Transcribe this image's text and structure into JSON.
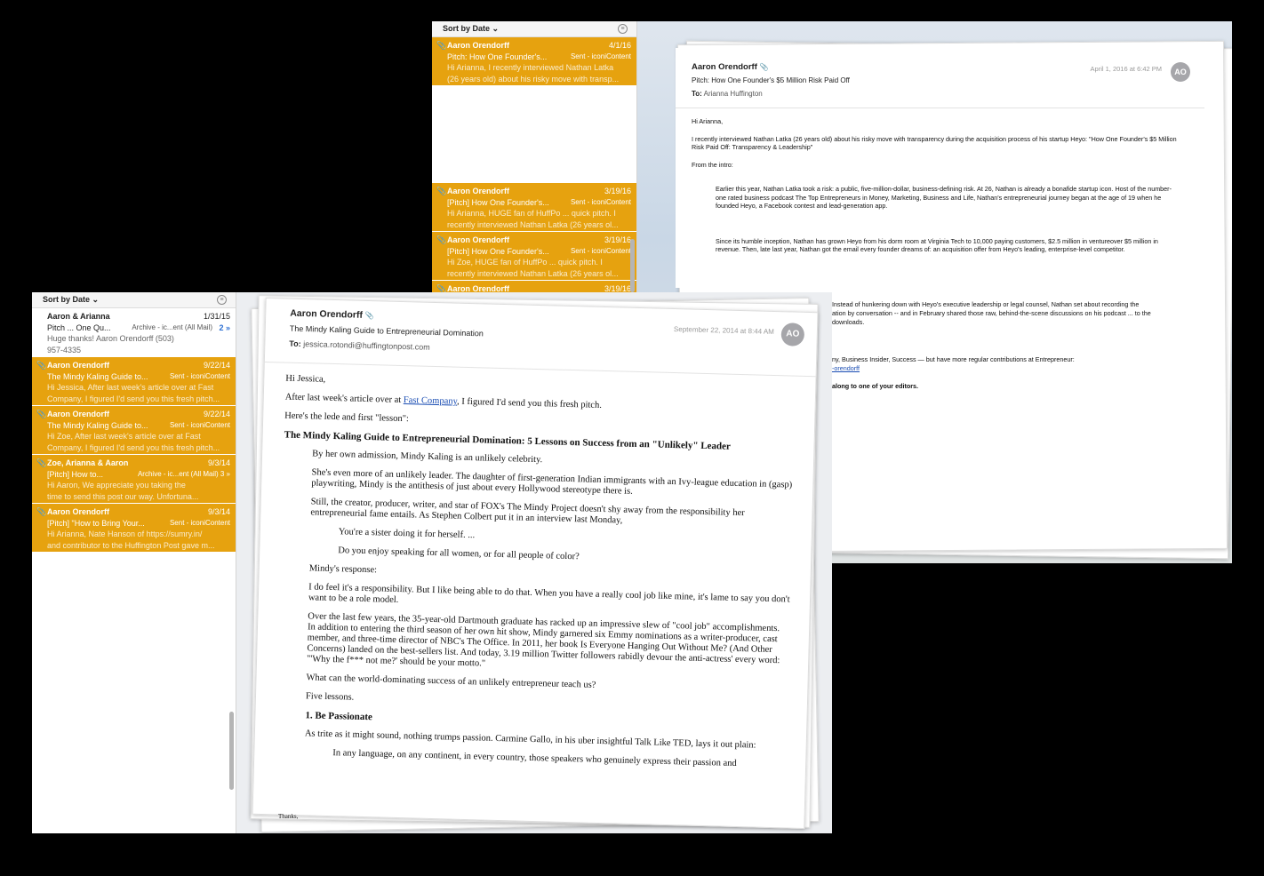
{
  "back_window": {
    "sort_label": "Sort by Date ⌄",
    "filter_icon": "filter-icon",
    "messages": [
      {
        "from": "Aaron Orendorff",
        "date": "4/1/16",
        "subject": "Pitch: How One Founder's...",
        "folder": "Sent - iconiContent",
        "preview1": "Hi Arianna, I recently interviewed Nathan Latka",
        "preview2": "(26 years old) about his risky move with transp..."
      },
      {
        "from": "Aaron Orendorff",
        "date": "3/19/16",
        "subject": "[Pitch] How One Founder's...",
        "folder": "Sent - iconiContent",
        "preview1": "Hi Arianna, HUGE fan of HuffPo ... quick pitch. I",
        "preview2": "recently interviewed Nathan Latka (26 years ol..."
      },
      {
        "from": "Aaron Orendorff",
        "date": "3/19/16",
        "subject": "[Pitch] How One Founder's...",
        "folder": "Sent - iconiContent",
        "preview1": "Hi Zoe, HUGE fan of HuffPo ... quick pitch. I",
        "preview2": "recently interviewed Nathan Latka (26 years ol..."
      },
      {
        "from": "Aaron Orendorff",
        "date": "3/19/16"
      }
    ],
    "email": {
      "name": "Aaron Orendorff",
      "subject": "Pitch: How One Founder's $5 Million Risk Paid Off",
      "to_label": "To:",
      "to": "Arianna Huffington",
      "date": "April 1, 2016 at 6:42 PM",
      "avatar": "AO",
      "greeting": "Hi Arianna,",
      "p1": "I recently interviewed Nathan Latka (26 years old) about his risky move with transparency during the acquisition process of his startup Heyo: \"How One Founder's $5 Million Risk Paid Off: Transparency & Leadership\"",
      "p2": "From the intro:",
      "q1": "Earlier this year, Nathan Latka took a risk: a public, five-million-dollar, business-defining risk. At 26, Nathan is already a bonafide startup icon. Host of the number-one rated business podcast The Top Entrepreneurs in Money, Marketing, Business and Life, Nathan's entrepreneurial journey began at the age of 19 when he founded Heyo, a Facebook contest and lead-generation app.",
      "q2": "Since its humble inception, Nathan has grown Heyo from his dorm room at Virginia Tech to 10,000 paying customers, $2.5 million in ventureover $5 million in revenue. Then, late last year, Nathan got the email every founder dreams of: an acquisition offer from Heyo's leading, enterprise-level competitor.",
      "q3a": "Instead of hunkering down with Heyo's executive leadership or legal counsel, Nathan set about recording the",
      "q3b": "ation by conversation -- and in February shared those raw, behind-the-scene discussions on his podcast ... to the",
      "q3c": "downloads.",
      "p3": "ny, Business Insider, Success — but have more regular contributions at Entrepreneur:",
      "p3link": "-orendorff",
      "p4": "along to one of your editors."
    }
  },
  "front_window": {
    "sort_label": "Sort by Date ⌄",
    "filter_icon": "filter-icon",
    "messages": [
      {
        "from": "Aaron & Arianna",
        "date": "1/31/15",
        "subject": "Pitch ... One Qu...",
        "folder": "Archive - ic...ent (All Mail)",
        "count": "2 »",
        "preview1": "Huge thanks! Aaron Orendorff (503)",
        "preview2": "957-4335"
      },
      {
        "from": "Aaron Orendorff",
        "date": "9/22/14",
        "subject": "The Mindy Kaling Guide to...",
        "folder": "Sent - iconiContent",
        "preview1": "Hi Jessica, After last week's article over at Fast",
        "preview2": "Company, I figured I'd send you this fresh pitch..."
      },
      {
        "from": "Aaron Orendorff",
        "date": "9/22/14",
        "subject": "The Mindy Kaling Guide to...",
        "folder": "Sent - iconiContent",
        "preview1": "Hi Zoe, After last week's article over at Fast",
        "preview2": "Company, I figured I'd send you this fresh pitch..."
      },
      {
        "from": "Zoe, Arianna & Aaron",
        "date": "9/3/14",
        "subject": "[Pitch] How to...",
        "folder": "Archive - ic...ent (All Mail)  3 »",
        "preview1": "Hi Aaron, We appreciate you taking the",
        "preview2": "time to send this post our way. Unfortuna..."
      },
      {
        "from": "Aaron Orendorff",
        "date": "9/3/14",
        "subject": "[Pitch] \"How to Bring Your...",
        "folder": "Sent - iconiContent",
        "preview1": "Hi Arianna, Nate Hanson of https://sumry.in/",
        "preview2": "and contributor to the Huffington Post gave m..."
      }
    ],
    "email": {
      "name": "Aaron Orendorff",
      "subject": "The Mindy Kaling Guide to Entrepreneurial Domination",
      "to_label": "To:",
      "to": "jessica.rotondi@huffingtonpost.com",
      "date": "September 22, 2014 at 8:44 AM",
      "avatar": "AO",
      "greeting": "Hi Jessica,",
      "p1a": "After last week's article over at ",
      "p1link": "Fast Company",
      "p1b": ", I figured I'd send you this fresh pitch.",
      "p2": "Here's the lede and first \"lesson\":",
      "headline": "The Mindy Kaling Guide to Entrepreneurial Domination: 5 Lessons on Success from an \"Unlikely\" Leader",
      "b1": "By her own admission, Mindy Kaling is an unlikely celebrity.",
      "b2": "She's even more of an unlikely leader. The daughter of first-generation Indian immigrants with an Ivy-league education in (gasp) playwriting, Mindy is the antithesis of just about every Hollywood stereotype there is.",
      "b3": "Still, the creator, producer, writer, and star of FOX's The Mindy Project doesn't shy away from the responsibility her entrepreneurial fame entails. As Stephen Colbert put it in an interview last Monday,",
      "b4": "You're a sister doing it for herself. ...",
      "b5": "Do you enjoy speaking for all women, or for all people of color?",
      "b6": "Mindy's response:",
      "b7": "I do feel it's a responsibility. But I like being able to do that. When you have a really cool job like mine, it's lame to say you don't want to be a role model.",
      "b8": "Over the last few years, the 35-year-old Dartmouth graduate has racked up an impressive slew of \"cool job\" accomplishments. In addition to entering the third season of her own hit show, Mindy garnered six Emmy nominations as a writer-producer, cast member, and three-time director of NBC's The Office. In 2011, her book Is Everyone Hanging Out Without Me? (And Other Concerns) landed on the best-sellers list. And today, 3.19 million Twitter followers rabidly devour the anti-actress' every word: \"'Why the f*** not me?' should be your motto.\"",
      "b9": "What can the world-dominating success of an unlikely entrepreneur teach us?",
      "b10": "Five lessons.",
      "h1": "1. Be Passionate",
      "b11": "As trite as it might sound, nothing trumps passion. Carmine Gallo, in his uber insightful Talk Like TED, lays it out plain:",
      "b12": "In any language, on any continent, in every country, those speakers who genuinely express their passion and",
      "thanks": "Thanks,"
    }
  }
}
